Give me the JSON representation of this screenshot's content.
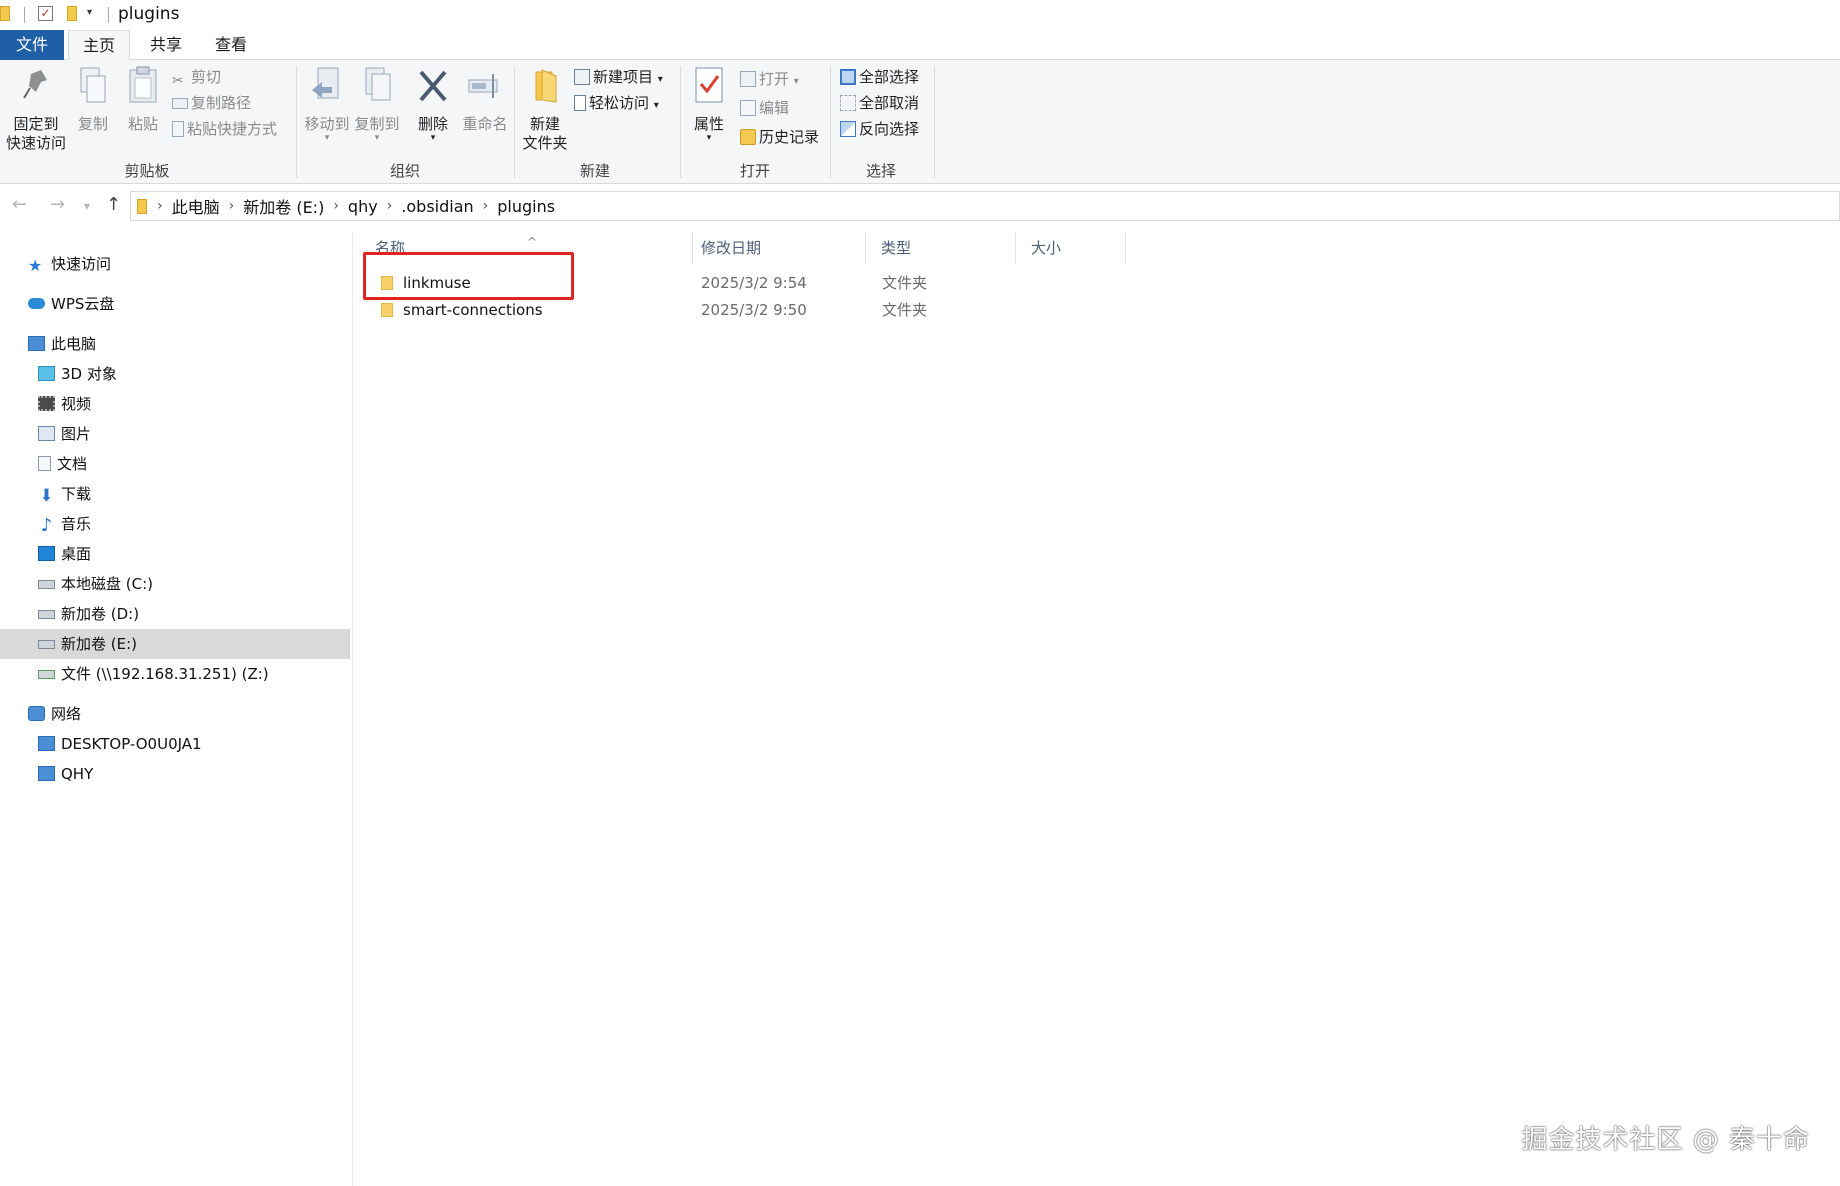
{
  "window": {
    "title": "plugins"
  },
  "ribbon_tabs": [
    "文件",
    "主页",
    "共享",
    "查看"
  ],
  "ribbon": {
    "clipboard": {
      "label": "剪贴板",
      "pin_label_1": "固定到",
      "pin_label_2": "快速访问",
      "copy_label": "复制",
      "paste_label": "粘贴",
      "cut_label": "剪切",
      "copy_path_label": "复制路径",
      "paste_shortcut_label": "粘贴快捷方式"
    },
    "organize": {
      "label": "组织",
      "move_to_label": "移动到",
      "copy_to_label": "复制到",
      "delete_label": "删除",
      "rename_label": "重命名"
    },
    "new": {
      "label": "新建",
      "new_folder_label_1": "新建",
      "new_folder_label_2": "文件夹",
      "new_item_label": "新建项目",
      "easy_access_label": "轻松访问"
    },
    "open": {
      "label": "打开",
      "properties_label": "属性",
      "open_label": "打开",
      "edit_label": "编辑",
      "history_label": "历史记录"
    },
    "select": {
      "label": "选择",
      "select_all_label": "全部选择",
      "select_none_label": "全部取消",
      "invert_label": "反向选择"
    }
  },
  "address": {
    "crumbs": [
      "此电脑",
      "新加卷 (E:)",
      "qhy",
      ".obsidian",
      "plugins"
    ]
  },
  "nav": {
    "quick_access": "快速访问",
    "wps": "WPS云盘",
    "this_pc": "此电脑",
    "objects3d": "3D 对象",
    "videos": "视频",
    "pictures": "图片",
    "documents": "文档",
    "downloads": "下载",
    "music": "音乐",
    "desktop": "桌面",
    "drive_c": "本地磁盘 (C:)",
    "drive_d": "新加卷 (D:)",
    "drive_e": "新加卷 (E:)",
    "drive_z": "文件 (\\\\192.168.31.251) (Z:)",
    "network": "网络",
    "net_pc1": "DESKTOP-O0U0JA1",
    "net_pc2": "QHY"
  },
  "columns": {
    "name": "名称",
    "date": "修改日期",
    "type": "类型",
    "size": "大小"
  },
  "files": [
    {
      "name": "linkmuse",
      "date": "2025/3/2 9:54",
      "type": "文件夹"
    },
    {
      "name": "smart-connections",
      "date": "2025/3/2 9:50",
      "type": "文件夹"
    }
  ],
  "watermark": "掘金技术社区 @ 秦十命",
  "colors": {
    "accent": "#1f5fa8",
    "highlight_box": "#e0241f",
    "folder": "#f7d16b"
  }
}
